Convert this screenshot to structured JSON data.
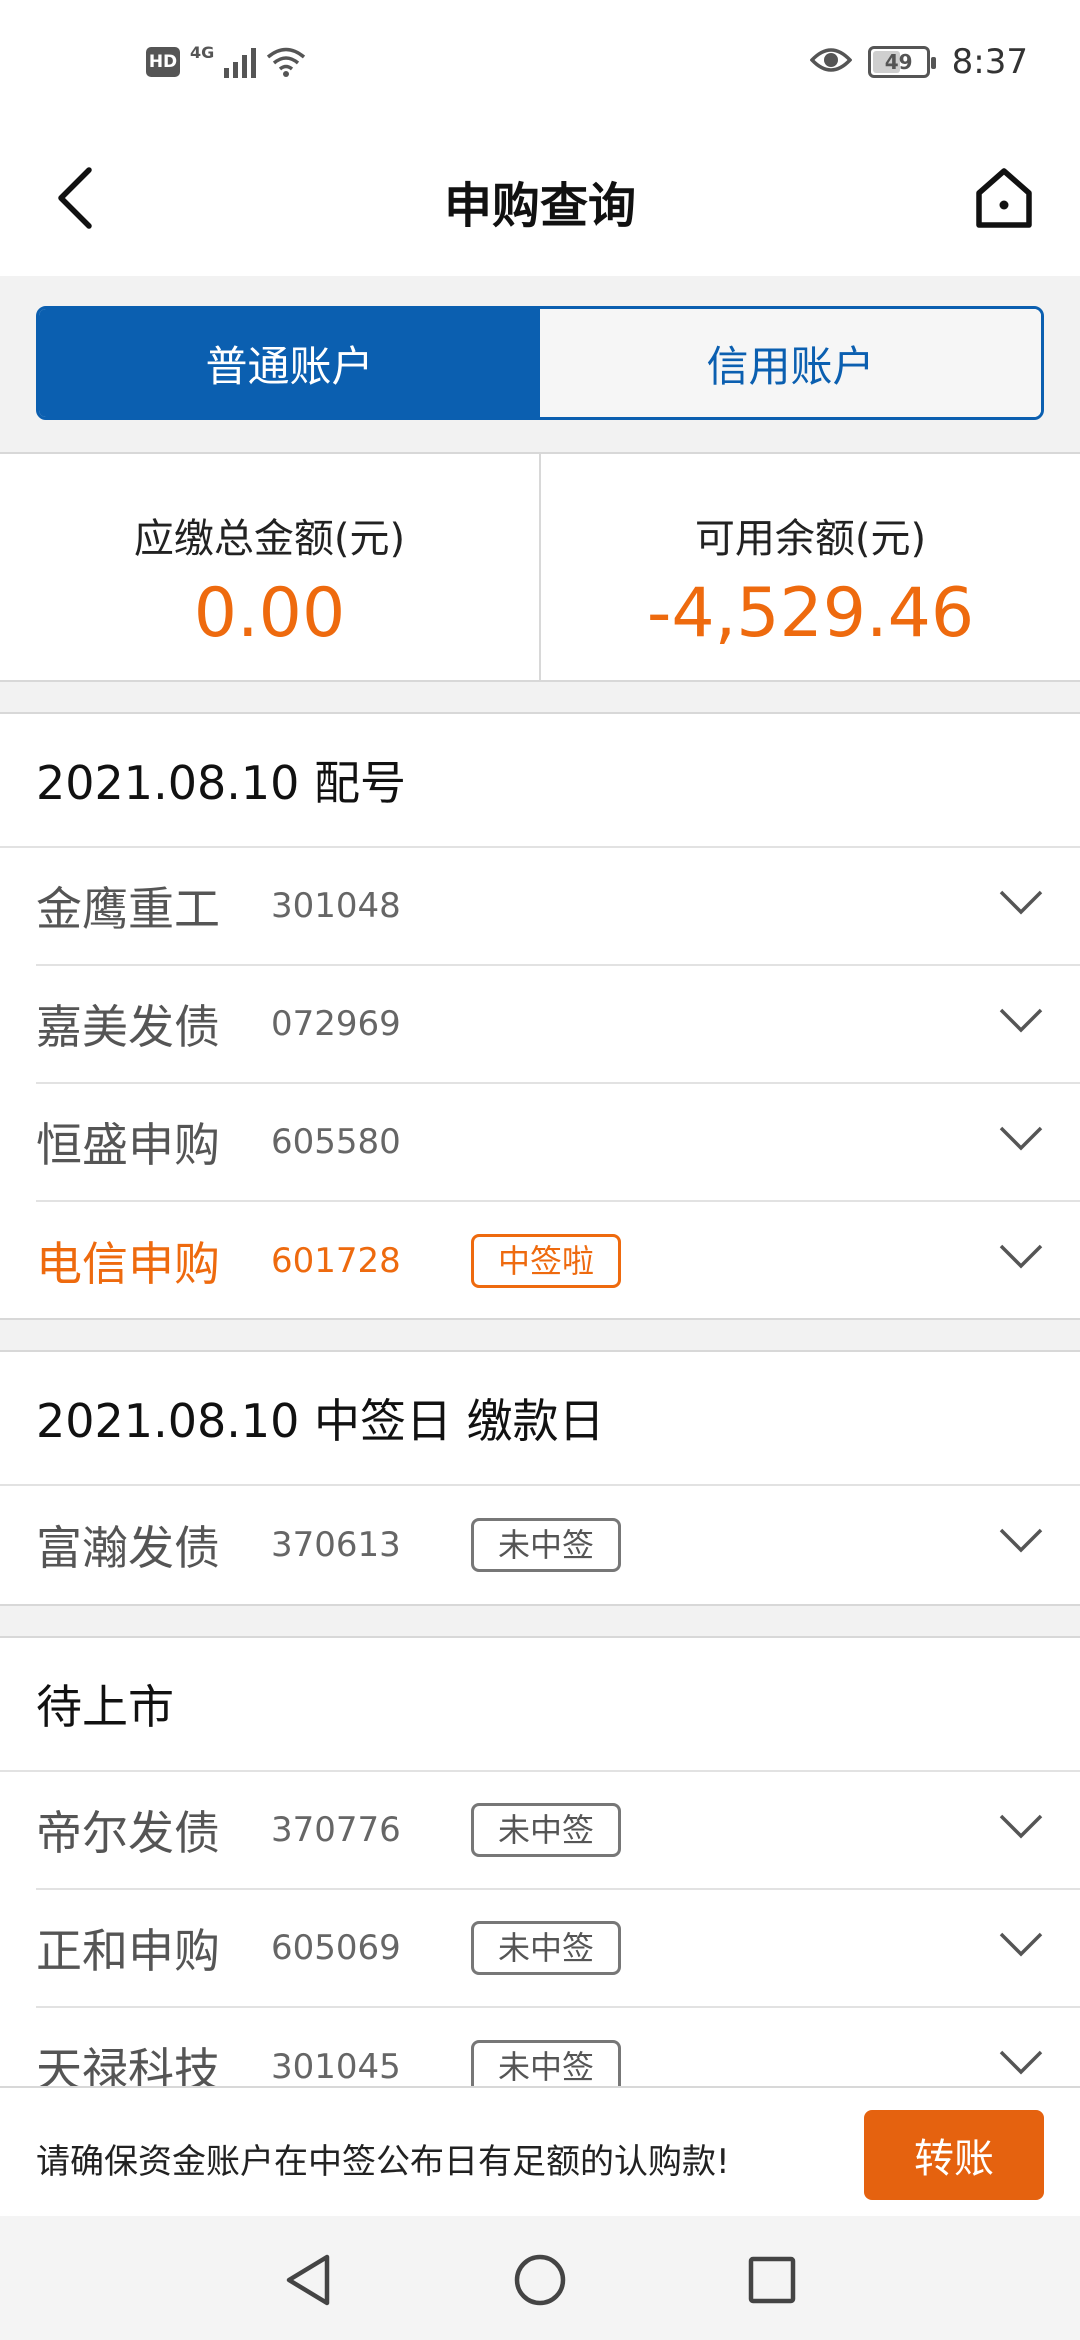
{
  "status_bar": {
    "hd_label": "HD",
    "network_label": "4G",
    "battery_level": "49",
    "time": "8:37"
  },
  "header": {
    "title": "申购查询",
    "back_icon": "chevron-left-icon",
    "home_icon": "home-icon"
  },
  "tabs": [
    {
      "label": "普通账户",
      "active": true
    },
    {
      "label": "信用账户",
      "active": false
    }
  ],
  "summary": {
    "due_label": "应缴总金额(元)",
    "due_value": "0.00",
    "available_label": "可用余额(元)",
    "available_value": "-4,529.46"
  },
  "sections": [
    {
      "title": "2021.08.10 配号",
      "rows": [
        {
          "name": "金鹰重工",
          "code": "301048",
          "badge": ""
        },
        {
          "name": "嘉美发债",
          "code": "072969",
          "badge": ""
        },
        {
          "name": "恒盛申购",
          "code": "605580",
          "badge": ""
        },
        {
          "name": "电信申购",
          "code": "601728",
          "badge": "中签啦"
        }
      ]
    },
    {
      "title": "2021.08.10 中签日 缴款日",
      "rows": [
        {
          "name": "富瀚发债",
          "code": "370613",
          "badge": "未中签"
        }
      ]
    },
    {
      "title": "待上市",
      "rows": [
        {
          "name": "帝尔发债",
          "code": "370776",
          "badge": "未中签"
        },
        {
          "name": "正和申购",
          "code": "605069",
          "badge": "未中签"
        },
        {
          "name": "天禄科技",
          "code": "301045",
          "badge": "未中签"
        }
      ]
    }
  ],
  "notice": {
    "text": "请确保资金账户在中签公布日有足额的认购款!",
    "button_label": "转账"
  },
  "colors": {
    "primary_blue": "#0b5fb0",
    "accent_orange": "#ee6a0e",
    "button_orange": "#e5620f"
  }
}
